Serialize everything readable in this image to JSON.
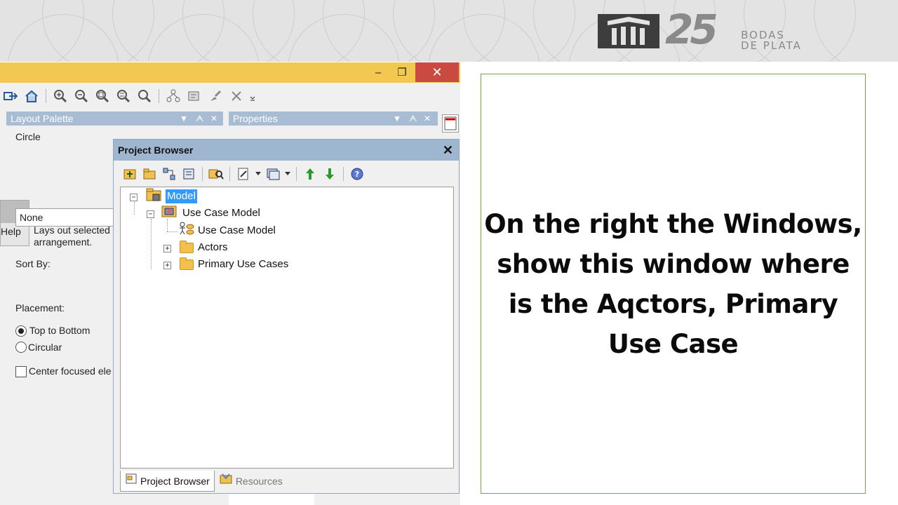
{
  "logo": {
    "line1": "BODAS",
    "line2": "DE PLATA",
    "number": "25"
  },
  "window": {
    "minimize_icon": "–",
    "restore_icon": "❐",
    "close_icon": "✕"
  },
  "toolbar": {
    "icons": [
      "export-icon",
      "home-icon",
      "zoom-in-icon",
      "zoom-out-icon",
      "zoom-fit-icon",
      "zoom-reset-icon",
      "zoom-icon",
      "layout-icon",
      "format-icon",
      "brush-icon",
      "delete-icon",
      "more-icon"
    ]
  },
  "layout_palette": {
    "title": "Layout Palette",
    "selected": "Circle",
    "help_label": "Help",
    "description_line1": "Lays out selected",
    "description_line2": "arrangement.",
    "sort_by_label": "Sort By:",
    "sort_by_value": "None",
    "placement_label": "Placement:",
    "option_top_to_bottom": "Top to Bottom",
    "option_circular": "Circular",
    "checkbox_center": "Center focused ele"
  },
  "properties": {
    "title": "Properties"
  },
  "project_browser": {
    "title": "Project Browser",
    "close_icon": "✕",
    "tree": {
      "root": "Model",
      "package": "Use Case Model",
      "diagram": "Use Case Model",
      "folder_actors": "Actors",
      "folder_primary": "Primary Use Cases"
    },
    "tabs": {
      "project_browser": "Project Browser",
      "resources": "Resources"
    }
  },
  "callout": {
    "text": "On the right the Windows, show this window where is the Aqctors, Primary Use Case"
  }
}
